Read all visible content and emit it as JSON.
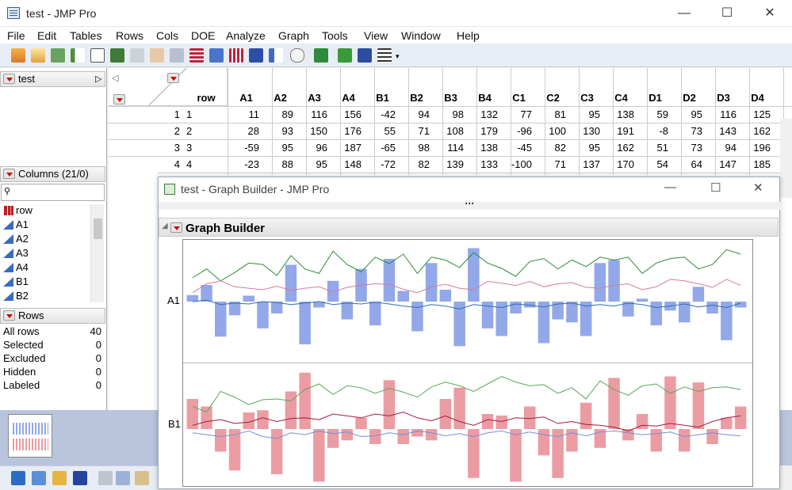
{
  "window": {
    "title": "test - JMP Pro",
    "minimize_icon": "minimize-icon",
    "maximize_icon": "maximize-icon",
    "close_icon": "close-icon"
  },
  "menu": [
    "File",
    "Edit",
    "Tables",
    "Rows",
    "Cols",
    "DOE",
    "Analyze",
    "Graph",
    "Tools",
    "View",
    "Window",
    "Help"
  ],
  "left_panel": {
    "table_name": "test",
    "columns_header": "Columns (21/0)",
    "columns": [
      "row",
      "A1",
      "A2",
      "A3",
      "A4",
      "B1",
      "B2"
    ],
    "rows_header": "Rows",
    "rows_stats": [
      {
        "label": "All rows",
        "value": "40"
      },
      {
        "label": "Selected",
        "value": "0"
      },
      {
        "label": "Excluded",
        "value": "0"
      },
      {
        "label": "Hidden",
        "value": "0"
      },
      {
        "label": "Labeled",
        "value": "0"
      }
    ]
  },
  "table": {
    "headers": [
      "row",
      "A1",
      "A2",
      "A3",
      "A4",
      "B1",
      "B2",
      "B3",
      "B4",
      "C1",
      "C2",
      "C3",
      "C4",
      "D1",
      "D2",
      "D3",
      "D4"
    ],
    "rows": [
      {
        "n": "1",
        "cells": [
          "1",
          "11",
          "89",
          "116",
          "156",
          "-42",
          "94",
          "98",
          "132",
          "77",
          "81",
          "95",
          "138",
          "59",
          "95",
          "116",
          "125"
        ]
      },
      {
        "n": "2",
        "cells": [
          "2",
          "28",
          "93",
          "150",
          "176",
          "55",
          "71",
          "108",
          "179",
          "-96",
          "100",
          "130",
          "191",
          "-8",
          "73",
          "143",
          "162"
        ]
      },
      {
        "n": "3",
        "cells": [
          "3",
          "-59",
          "95",
          "96",
          "187",
          "-65",
          "98",
          "114",
          "138",
          "-45",
          "82",
          "95",
          "162",
          "51",
          "73",
          "94",
          "196"
        ]
      },
      {
        "n": "4",
        "cells": [
          "4",
          "-23",
          "88",
          "95",
          "148",
          "-72",
          "82",
          "139",
          "133",
          "-100",
          "71",
          "137",
          "170",
          "54",
          "64",
          "147",
          "185"
        ]
      }
    ]
  },
  "graph_builder": {
    "window_title": "test - Graph Builder - JMP Pro",
    "outline_title": "Graph Builder",
    "colors": {
      "blue_bar": "#92a8e8",
      "blue_line": "#2f6db5",
      "green_line": "#2e8b3a",
      "pink_line": "#d77a9a",
      "red_bar": "#eb9ca3",
      "red_line": "#a8173a",
      "lightgreen_line": "#5aa65a",
      "lightblue_line": "#6f93d6"
    }
  },
  "chart_data": [
    {
      "type": "bar",
      "title": "",
      "ylabel": "A1",
      "series": [
        {
          "name": "",
          "type": "bar",
          "values": [
            11,
            28,
            -59,
            -23,
            10,
            -45,
            -20,
            62,
            -72,
            -10,
            35,
            -30,
            55,
            -40,
            72,
            18,
            -50,
            65,
            20,
            -75,
            90,
            -45,
            -58,
            -20,
            -10,
            -70,
            -30,
            -35,
            -58,
            65,
            70,
            -25,
            5,
            -40,
            -15,
            -35,
            25,
            -20,
            -65,
            -10
          ]
        },
        {
          "name": "",
          "type": "line",
          "values": [
            80,
            110,
            70,
            98,
            130,
            125,
            88,
            155,
            110,
            95,
            170,
            125,
            100,
            150,
            128,
            160,
            95,
            150,
            140,
            115,
            165,
            130,
            112,
            85,
            135,
            145,
            110,
            140,
            118,
            150,
            140,
            150,
            95,
            130,
            145,
            150,
            110,
            125,
            175,
            160
          ]
        },
        {
          "name": "",
          "type": "line",
          "values": [
            30,
            60,
            70,
            50,
            45,
            40,
            52,
            38,
            45,
            50,
            32,
            48,
            55,
            60,
            58,
            42,
            30,
            50,
            58,
            45,
            40,
            68,
            62,
            54,
            68,
            50,
            60,
            64,
            48,
            45,
            55,
            60,
            40,
            50,
            75,
            70,
            60,
            48,
            75,
            55
          ]
        },
        {
          "name": "",
          "type": "line",
          "values": [
            0,
            5,
            -10,
            -5,
            -8,
            0,
            -3,
            -10,
            -5,
            0,
            -10,
            -5,
            -8,
            -2,
            -8,
            -15,
            -20,
            -10,
            -15,
            -25,
            -10,
            -15,
            -20,
            -8,
            -12,
            -18,
            -8,
            -5,
            -15,
            -10,
            -15,
            -5,
            -10,
            -20,
            -15,
            -8,
            -18,
            -12,
            -20,
            -5
          ]
        }
      ]
    },
    {
      "type": "bar",
      "title": "",
      "ylabel": "B1",
      "series": [
        {
          "name": "",
          "type": "bar",
          "values": [
            40,
            30,
            -30,
            -55,
            22,
            25,
            -60,
            50,
            75,
            -70,
            -25,
            -15,
            15,
            -20,
            65,
            -20,
            -10,
            -15,
            40,
            55,
            -65,
            20,
            18,
            -70,
            30,
            -35,
            -65,
            -30,
            35,
            -25,
            68,
            -15,
            20,
            -30,
            70,
            -30,
            62,
            -20,
            15,
            30
          ]
        },
        {
          "name": "",
          "type": "line",
          "values": [
            60,
            45,
            100,
            85,
            65,
            78,
            80,
            75,
            105,
            120,
            92,
            115,
            110,
            95,
            108,
            98,
            85,
            112,
            125,
            115,
            100,
            120,
            140,
            125,
            115,
            118,
            95,
            110,
            80,
            128,
            105,
            90,
            115,
            120,
            95,
            112,
            100,
            110,
            112,
            105
          ]
        },
        {
          "name": "",
          "type": "line",
          "values": [
            10,
            20,
            25,
            15,
            18,
            30,
            20,
            28,
            30,
            25,
            40,
            35,
            30,
            40,
            35,
            45,
            30,
            22,
            35,
            20,
            10,
            25,
            20,
            30,
            28,
            32,
            15,
            20,
            12,
            10,
            5,
            -5,
            10,
            8,
            15,
            10,
            5,
            20,
            30,
            35
          ]
        },
        {
          "name": "",
          "type": "line",
          "values": [
            -10,
            -15,
            -20,
            -15,
            -5,
            -20,
            -25,
            -10,
            -15,
            -5,
            -12,
            -8,
            -20,
            -18,
            -10,
            -15,
            -5,
            -10,
            -18,
            -12,
            -20,
            -10,
            -5,
            -15,
            -8,
            -15,
            -20,
            -10,
            -18,
            -8,
            -5,
            -10,
            -15,
            -12,
            -8,
            -20,
            -15,
            -10,
            -15,
            -18
          ]
        }
      ]
    }
  ]
}
